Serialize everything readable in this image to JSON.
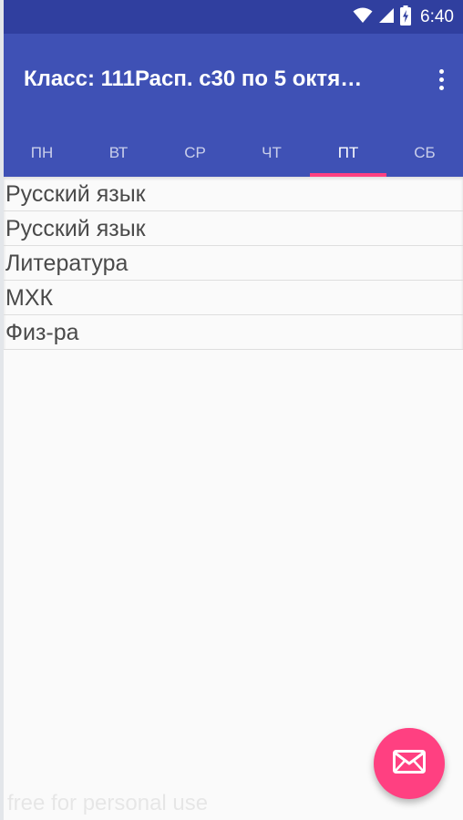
{
  "status_bar": {
    "time": "6:40",
    "icons": [
      "wifi-icon",
      "cell-signal-icon",
      "battery-charging-icon"
    ]
  },
  "app_bar": {
    "title": "Класс: 111Расп. с30 по 5 октя…",
    "overflow_icon": "more-vert-icon"
  },
  "tabs": [
    {
      "label": "ПН",
      "active": false
    },
    {
      "label": "ВТ",
      "active": false
    },
    {
      "label": "СР",
      "active": false
    },
    {
      "label": "ЧТ",
      "active": false
    },
    {
      "label": "ПТ",
      "active": true
    },
    {
      "label": "СБ",
      "active": false
    }
  ],
  "lessons": [
    "Русский язык",
    "Русский язык",
    "Литература",
    "МХК",
    "Физ-ра"
  ],
  "fab": {
    "icon": "mail-icon",
    "color": "#ff4081"
  },
  "watermark": "free for personal use",
  "colors": {
    "status_bar": "#303f9f",
    "primary": "#3f51b5",
    "accent": "#ff4081",
    "background": "#fafafa"
  }
}
